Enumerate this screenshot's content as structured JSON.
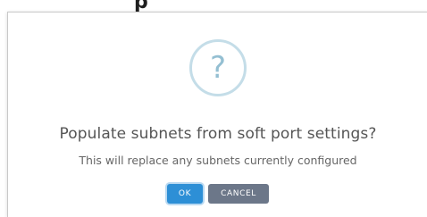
{
  "background": {
    "partial_text": "p"
  },
  "dialog": {
    "icon": "question-mark-icon",
    "icon_glyph": "?",
    "title": "Populate subnets from soft port settings?",
    "message": "This will replace any subnets currently configured",
    "ok_label": "OK",
    "cancel_label": "CANCEL"
  },
  "colors": {
    "ok_button": "#2d8fd6",
    "cancel_button": "#6c7789",
    "icon_ring": "#c4dde8",
    "icon_glyph": "#94bfd2",
    "title_text": "#555555"
  }
}
